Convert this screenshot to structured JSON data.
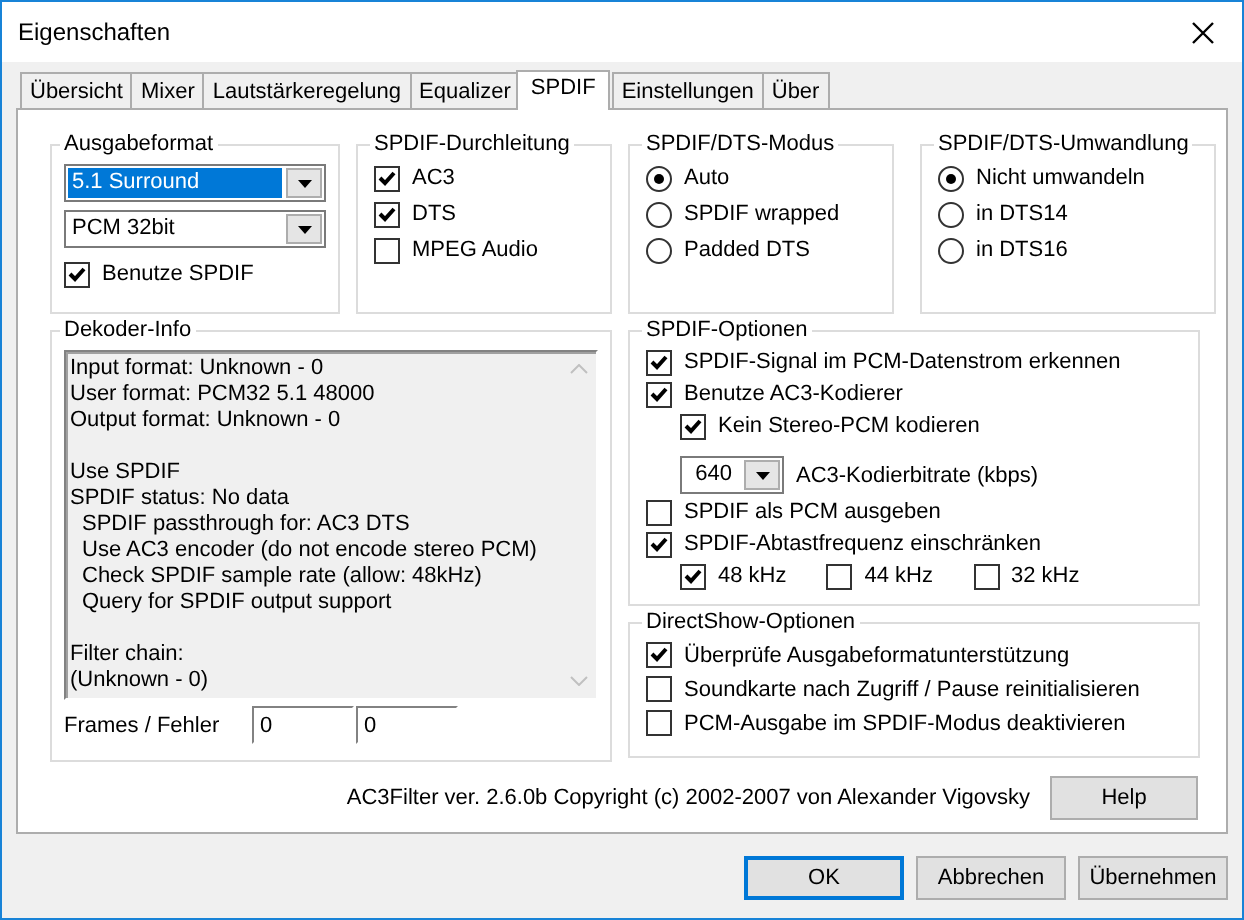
{
  "window": {
    "title": "Eigenschaften"
  },
  "tabs": [
    {
      "label": "Übersicht",
      "selected": false
    },
    {
      "label": "Mixer",
      "selected": false
    },
    {
      "label": "Lautstärkeregelung",
      "selected": false
    },
    {
      "label": "Equalizer",
      "selected": false
    },
    {
      "label": "SPDIF",
      "selected": true
    },
    {
      "label": "Einstellungen",
      "selected": false
    },
    {
      "label": "Über",
      "selected": false
    }
  ],
  "output_format": {
    "title": "Ausgabeformat",
    "format": {
      "value": "5.1 Surround",
      "focused": true
    },
    "sample_format": {
      "value": "PCM 32bit",
      "focused": false
    },
    "use_spdif": {
      "label": "Benutze SPDIF",
      "checked": true
    }
  },
  "passthrough": {
    "title": "SPDIF-Durchleitung",
    "options": [
      {
        "label": "AC3",
        "checked": true
      },
      {
        "label": "DTS",
        "checked": true
      },
      {
        "label": "MPEG Audio",
        "checked": false
      }
    ]
  },
  "dts_mode": {
    "title": "SPDIF/DTS-Modus",
    "options": [
      {
        "label": "Auto",
        "selected": true
      },
      {
        "label": "SPDIF wrapped",
        "selected": false
      },
      {
        "label": "Padded DTS",
        "selected": false
      }
    ]
  },
  "dts_conversion": {
    "title": "SPDIF/DTS-Umwandlung",
    "options": [
      {
        "label": "Nicht umwandeln",
        "selected": true
      },
      {
        "label": "in DTS14",
        "selected": false
      },
      {
        "label": "in DTS16",
        "selected": false
      }
    ]
  },
  "decoder_info": {
    "title": "Dekoder-Info",
    "blocks": [
      {
        "lines": [
          {
            "text": "Input format: Unknown - 0"
          },
          {
            "text": "User format: PCM32 5.1 48000"
          },
          {
            "text": "Output format: Unknown - 0"
          }
        ]
      },
      {
        "lines": [
          {
            "text": "Use SPDIF"
          },
          {
            "text": "SPDIF status: No data",
            "children": [
              {
                "text": "SPDIF passthrough for: AC3 DTS"
              },
              {
                "text": "Use AC3 encoder (do not encode stereo PCM)"
              },
              {
                "text": "Check SPDIF sample rate (allow: 48kHz)"
              },
              {
                "text": "Query for SPDIF output support"
              }
            ]
          }
        ]
      },
      {
        "lines": [
          {
            "text": "Filter chain:"
          },
          {
            "text": "(Unknown - 0)"
          }
        ]
      }
    ],
    "frames_label": "Frames / Fehler",
    "frames": "0",
    "errors": "0"
  },
  "spdif_options": {
    "title": "SPDIF-Optionen",
    "items": [
      {
        "kind": "checkbox",
        "label": "SPDIF-Signal im PCM-Datenstrom erkennen",
        "checked": true
      },
      {
        "kind": "checkbox",
        "label": "Benutze AC3-Kodierer",
        "checked": true,
        "children": [
          {
            "kind": "checkbox",
            "label": "Kein Stereo-PCM kodieren",
            "checked": true
          },
          {
            "kind": "dropdown",
            "value": "640",
            "label": "AC3-Kodierbitrate (kbps)"
          }
        ]
      },
      {
        "kind": "checkbox",
        "label": "SPDIF als PCM ausgeben",
        "checked": false
      },
      {
        "kind": "checkbox",
        "label": "SPDIF-Abtastfrequenz einschränken",
        "checked": true,
        "children": [
          {
            "kind": "inline_checkbox",
            "label": "48 kHz",
            "checked": true
          },
          {
            "kind": "inline_checkbox",
            "label": "44 kHz",
            "checked": false
          },
          {
            "kind": "inline_checkbox",
            "label": "32 kHz",
            "checked": false
          }
        ]
      }
    ]
  },
  "directshow_options": {
    "title": "DirectShow-Optionen",
    "items": [
      {
        "label": "Überprüfe Ausgabeformatunterstützung",
        "checked": true
      },
      {
        "label": "Soundkarte nach Zugriff / Pause reinitialisieren",
        "checked": false
      },
      {
        "label": "PCM-Ausgabe im SPDIF-Modus deaktivieren",
        "checked": false
      }
    ]
  },
  "copyright": "AC3Filter ver. 2.6.0b Copyright (c) 2002-2007 von Alexander Vigovsky",
  "help_button": "Help",
  "buttons": [
    {
      "label": "OK",
      "default": true
    },
    {
      "label": "Abbrechen",
      "default": false
    },
    {
      "label": "Übernehmen",
      "default": false
    }
  ]
}
